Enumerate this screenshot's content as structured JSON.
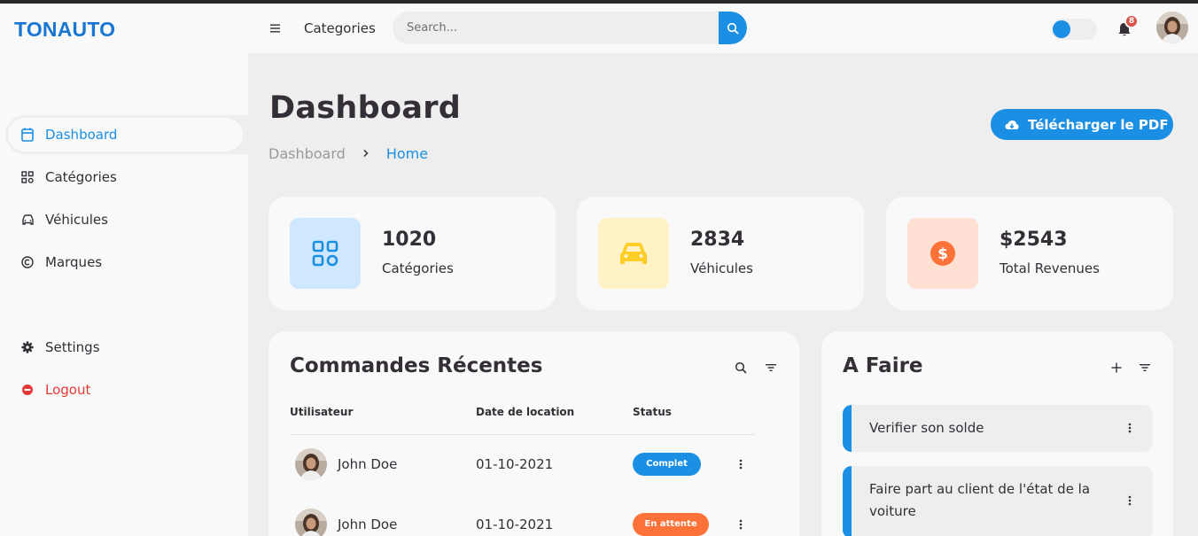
{
  "brand": "TONAUTO",
  "sidebar": {
    "items": [
      {
        "label": "Dashboard",
        "icon": "dashboard-icon",
        "active": true
      },
      {
        "label": "Catégories",
        "icon": "grid-icon"
      },
      {
        "label": "Véhicules",
        "icon": "car-icon"
      },
      {
        "label": "Marques",
        "icon": "copyright-icon"
      }
    ],
    "bottom": [
      {
        "label": "Settings",
        "icon": "gear-icon"
      },
      {
        "label": "Logout",
        "icon": "logout-icon"
      }
    ]
  },
  "navbar": {
    "categories_label": "Categories",
    "search_placeholder": "Search...",
    "notification_count": "8"
  },
  "header": {
    "title": "Dashboard",
    "breadcrumb": [
      "Dashboard",
      "Home"
    ],
    "download_label": "Télécharger le PDF"
  },
  "stats": [
    {
      "value": "1020",
      "label": "Catégories",
      "icon": "grid-icon",
      "color": "#cfe8ff"
    },
    {
      "value": "2834",
      "label": "Véhicules",
      "icon": "car-icon",
      "color": "#fff2c6"
    },
    {
      "value": "$2543",
      "label": "Total Revenues",
      "icon": "dollar-icon",
      "color": "#ffe0d3"
    }
  ],
  "orders": {
    "title": "Commandes Récentes",
    "columns": [
      "Utilisateur",
      "Date de location",
      "Status"
    ],
    "rows": [
      {
        "user": "John Doe",
        "date": "01-10-2021",
        "status": "Complet"
      },
      {
        "user": "John Doe",
        "date": "01-10-2021",
        "status": "En attente"
      }
    ]
  },
  "todos": {
    "title": "A Faire",
    "items": [
      {
        "text": "Verifier son solde"
      },
      {
        "text": "Faire part au client de l'état de la voiture"
      }
    ]
  },
  "colors": {
    "accent": "#1a8fe3",
    "orange": "#fd7238",
    "red": "#db504a",
    "yellow": "#ffce26"
  }
}
